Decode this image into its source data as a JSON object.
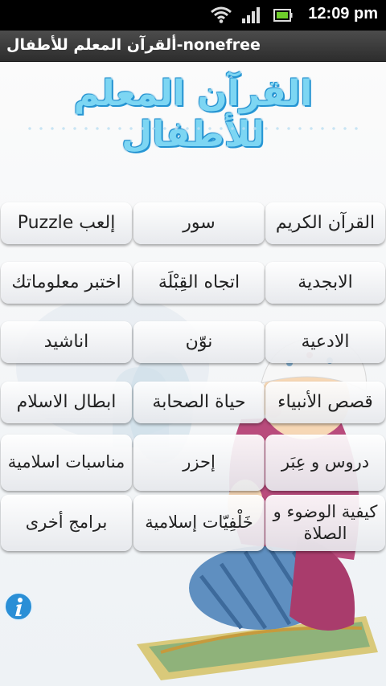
{
  "status_bar": {
    "time": "12:09 pm"
  },
  "title_bar": {
    "title": "ألقرآن المعلم للأطفال-nonefree"
  },
  "logo": {
    "text": "القرآن المعلم للأطفال"
  },
  "menu": [
    "إلعب Puzzle",
    "سور",
    "القرآن الكريم",
    "اختبر معلوماتك",
    "اتجاه القِبْلَة",
    "الابجدية",
    "اناشيد",
    "نوّن",
    "الادعية",
    "ابطال الاسلام",
    "حياة الصحابة",
    "قصص الأنبياء",
    "مناسبات اسلامية",
    "إحزر",
    "دروس و عِبَر",
    "برامج أخرى",
    "خَلْفِيّات إسلامية",
    "كيفية الوضوء و الصلاة"
  ],
  "colors": {
    "logo": "#7dd6f3",
    "info": "#2a8fd6"
  }
}
